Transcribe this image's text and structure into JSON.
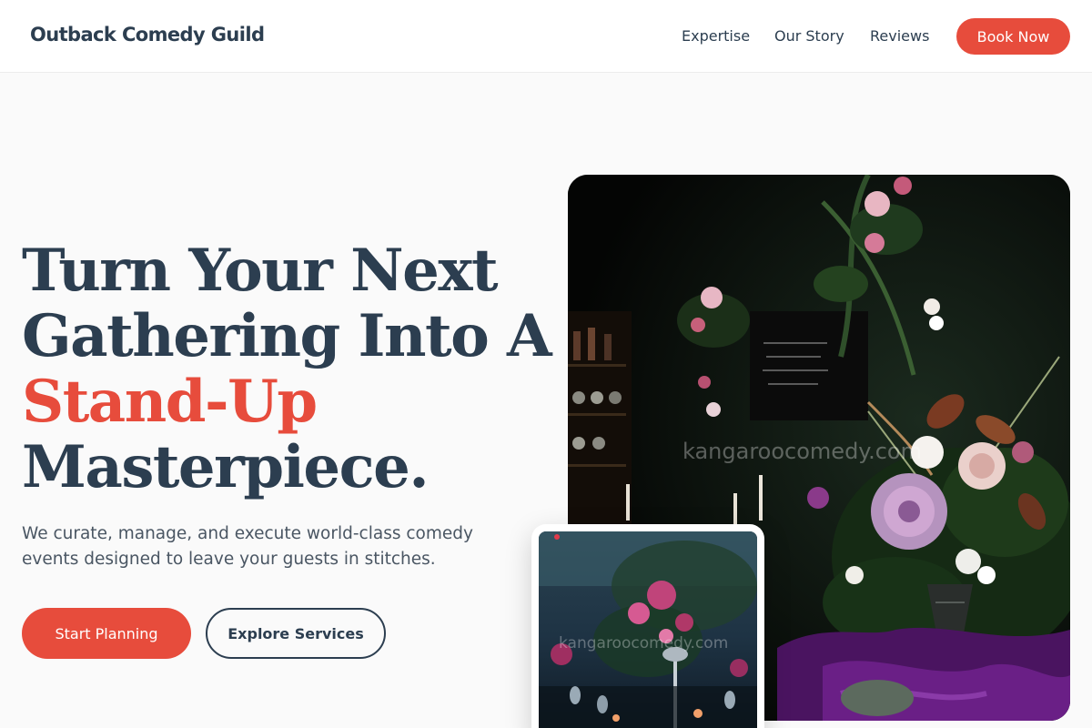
{
  "header": {
    "brand": "Outback Comedy Guild",
    "nav": [
      {
        "label": "Expertise"
      },
      {
        "label": "Our Story"
      },
      {
        "label": "Reviews"
      }
    ],
    "cta_label": "Book Now"
  },
  "hero": {
    "headline_lines": [
      "Turn Your Next",
      "Gathering Into A",
      "Stand-Up",
      "Masterpiece."
    ],
    "subtitle": "We curate, manage, and execute world-class comedy events designed to leave your guests in stitches.",
    "primary_button": "Start Planning",
    "secondary_button": "Explore Services"
  },
  "images": {
    "main_watermark": "kangaroocomedy.com",
    "inset_watermark": "kangaroocomedy.com"
  },
  "colors": {
    "primary_text": "#2c3e50",
    "accent": "#e74c3c",
    "background": "#fafafa"
  }
}
